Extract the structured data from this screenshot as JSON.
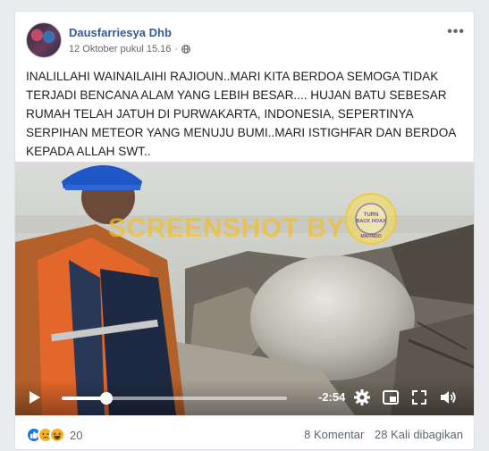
{
  "post": {
    "author": "Dausfarriesya Dhb",
    "timestamp": "12 Oktober pukul 15.16",
    "privacy_separator": "·",
    "more_label": "•••",
    "text": "INALILLAHI WAINAILAIHI RAJIOUN..MARI KITA BERDOA SEMOGA TIDAK TERJADI BENCANA ALAM YANG LEBIH BESAR.... HUJAN BATU SEBESAR RUMAH TELAH JATUH DI PURWAKARTA, INDONESIA, SEPERTINYA SERPIHAN METEOR YANG MENUJU BUMI..MARI ISTIGHFAR DAN BERDOA KEPADA ALLAH SWT.."
  },
  "video": {
    "watermark": "SCREENSHOT BY",
    "seal_text": "TURN BACK HOAX · MASYARAKAT ANTI FITNAH INDONESIA · MAFINDO",
    "remaining_time": "-2:54",
    "progress_fraction": 0.2,
    "icons": [
      "play-icon",
      "settings-icon",
      "picture-in-picture-icon",
      "fullscreen-icon",
      "volume-icon"
    ]
  },
  "footer": {
    "reaction_icons": [
      "like-icon",
      "sad-icon",
      "haha-icon"
    ],
    "reaction_count": "20",
    "comments": "8 Komentar",
    "shares": "28 Kali dibagikan"
  },
  "colors": {
    "author_link": "#385898",
    "like_blue": "#1877f2",
    "reaction_yellow": "#f7b125",
    "watermark": "#f5be28"
  }
}
